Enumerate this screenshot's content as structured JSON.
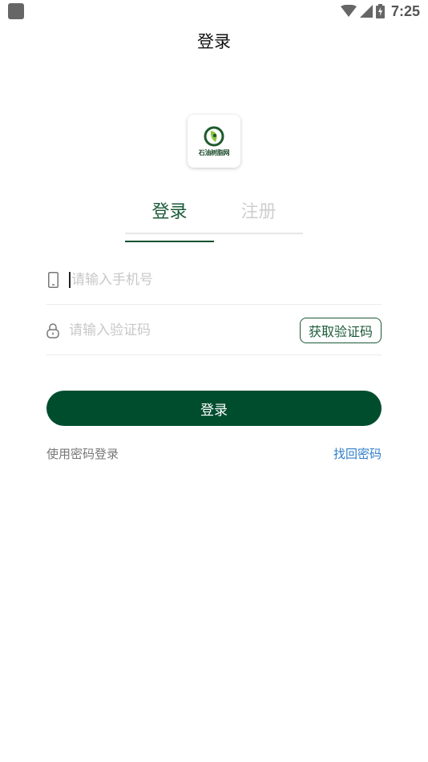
{
  "status_bar": {
    "time": "7:25",
    "icons": [
      "app-notification-icon",
      "wifi-icon",
      "signal-icon",
      "battery-charging-icon"
    ]
  },
  "app_bar": {
    "title": "登录"
  },
  "logo": {
    "text": "石油树脂网"
  },
  "tabs": [
    {
      "label": "登录",
      "active": true
    },
    {
      "label": "注册",
      "active": false
    }
  ],
  "form": {
    "phone": {
      "placeholder": "请输入手机号",
      "value": "",
      "icon": "phone-icon"
    },
    "code": {
      "placeholder": "请输入验证码",
      "value": "",
      "icon": "lock-icon",
      "button_label": "获取验证码"
    },
    "submit_label": "登录"
  },
  "links": {
    "password_login": "使用密码登录",
    "find_password": "找回密码"
  },
  "colors": {
    "brand_green": "#004d2e",
    "tab_active": "#1b5a38",
    "link_blue": "#2f7ecb"
  }
}
